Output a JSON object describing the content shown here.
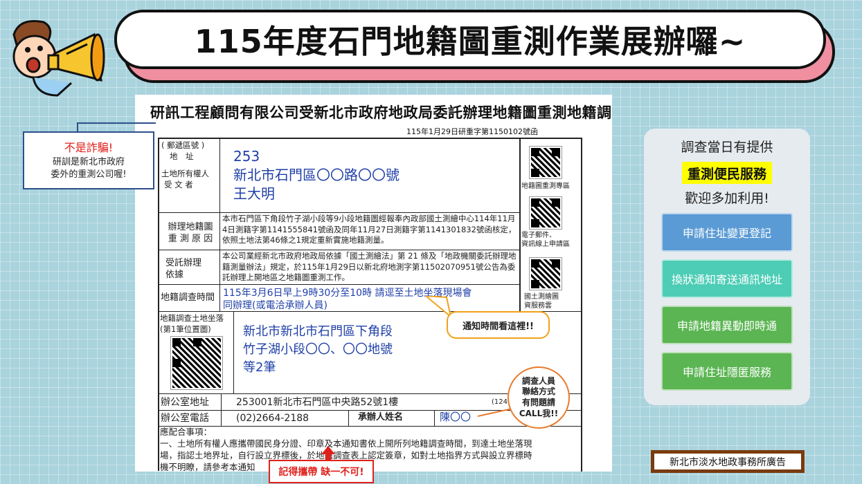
{
  "banner": {
    "title": "115年度石門地籍圖重測作業展辦囉~"
  },
  "doc": {
    "heading": "研訊工程顧問有限公司受新北市政府地政局委託辦理地籍圖重測地籍調查通知書",
    "ref": "115年1月29日研重字第1150102號函",
    "addr_labels": [
      "( 郵遞區號 )",
      "地　址",
      "土地所有權人",
      "受 文 者"
    ],
    "postal": "253",
    "address": "新北市石門區〇〇路〇〇號",
    "recipient": "王大明",
    "reason_label_1": "辦理地籍圖",
    "reason_label_2": "重 測 原 因",
    "reason_text": "本市石門區下角段竹子湖小段等9小段地籍圖經報奉內政部國土測繪中心114年11月4日測籍字第1141555841號函及同年11月27日測籍字第1141301832號函核定，依照土地法第46條之1規定重新實施地籍測量。",
    "entrust_label_1": "受託辦理",
    "entrust_label_2": "依據",
    "entrust_text": "本公司業經新北市政府地政局依據「國土測繪法」第 21 條及「地政機關委託辦理地籍測量辦法」規定，於115年1月29日以新北府地測字第11502070951號公告為委託辦理上開地區之地籍圖重測工作。",
    "survey_time_label": "地籍調查時間",
    "survey_time_1": "115年3月6日早上9時30分至10時  請逕至土地坐落現場會",
    "survey_time_2": "同辦理(或電洽承辦人員)",
    "land_label": "地籍調查土地坐落(第1筆位置圖)",
    "land_1": "新北市新北市石門區下角段",
    "land_2": "竹子湖小段〇〇、〇〇地號",
    "land_3": "等2筆",
    "office_addr_label": "辦公室地址",
    "office_addr": "253001新北市石門區中央路52號1樓",
    "office_addr_extra": "(124",
    "office_tel_label": "辦公室電話",
    "office_tel": "(02)2664-2188",
    "handler_label": "承辦人姓名",
    "handler": "陳〇〇",
    "notes_title": "應配合事項：",
    "notes_1": "一、土地所有權人應攜帶國民身分證、印章及本通知書依上開所列地籍調查時間，到達土地坐落現",
    "notes_2": "場，指認土地界址，自行設立界標後，於地籍調查表上認定簽章，如對土地指界方式與設立界標時",
    "notes_3": "機不明瞭，請參考本通知",
    "qr_labels": [
      "地籍圖重測專區",
      "電子郵件、",
      "資訊線上申請區",
      "國土測繪圖",
      "資服務雲"
    ]
  },
  "callouts": {
    "scam_title": "不是詐騙!",
    "scam_text_1": "研訓是新北市政府",
    "scam_text_2": "委外的重測公司喔!",
    "time_hint": "通知時間看這裡!!",
    "contact_1": "調查人員",
    "contact_2": "聯絡方式",
    "contact_3": "有問題請",
    "contact_4": "CALL我!!",
    "bring": "記得攜帶 缺一不可!"
  },
  "panel": {
    "line1": "調查當日有提供",
    "highlight": "重測便民服務",
    "line3": "歡迎多加利用!",
    "buttons": [
      {
        "label": "申請住址變更登記",
        "color": "#5b9bd5"
      },
      {
        "label": "換狀通知寄送通訊地址",
        "color": "#4dcdb6"
      },
      {
        "label": "申請地籍異動即時通",
        "color": "#5ab552"
      },
      {
        "label": "申請住址隱匿服務",
        "color": "#5ab552"
      }
    ]
  },
  "footer": {
    "label": "新北市淡水地政事務所廣告"
  }
}
